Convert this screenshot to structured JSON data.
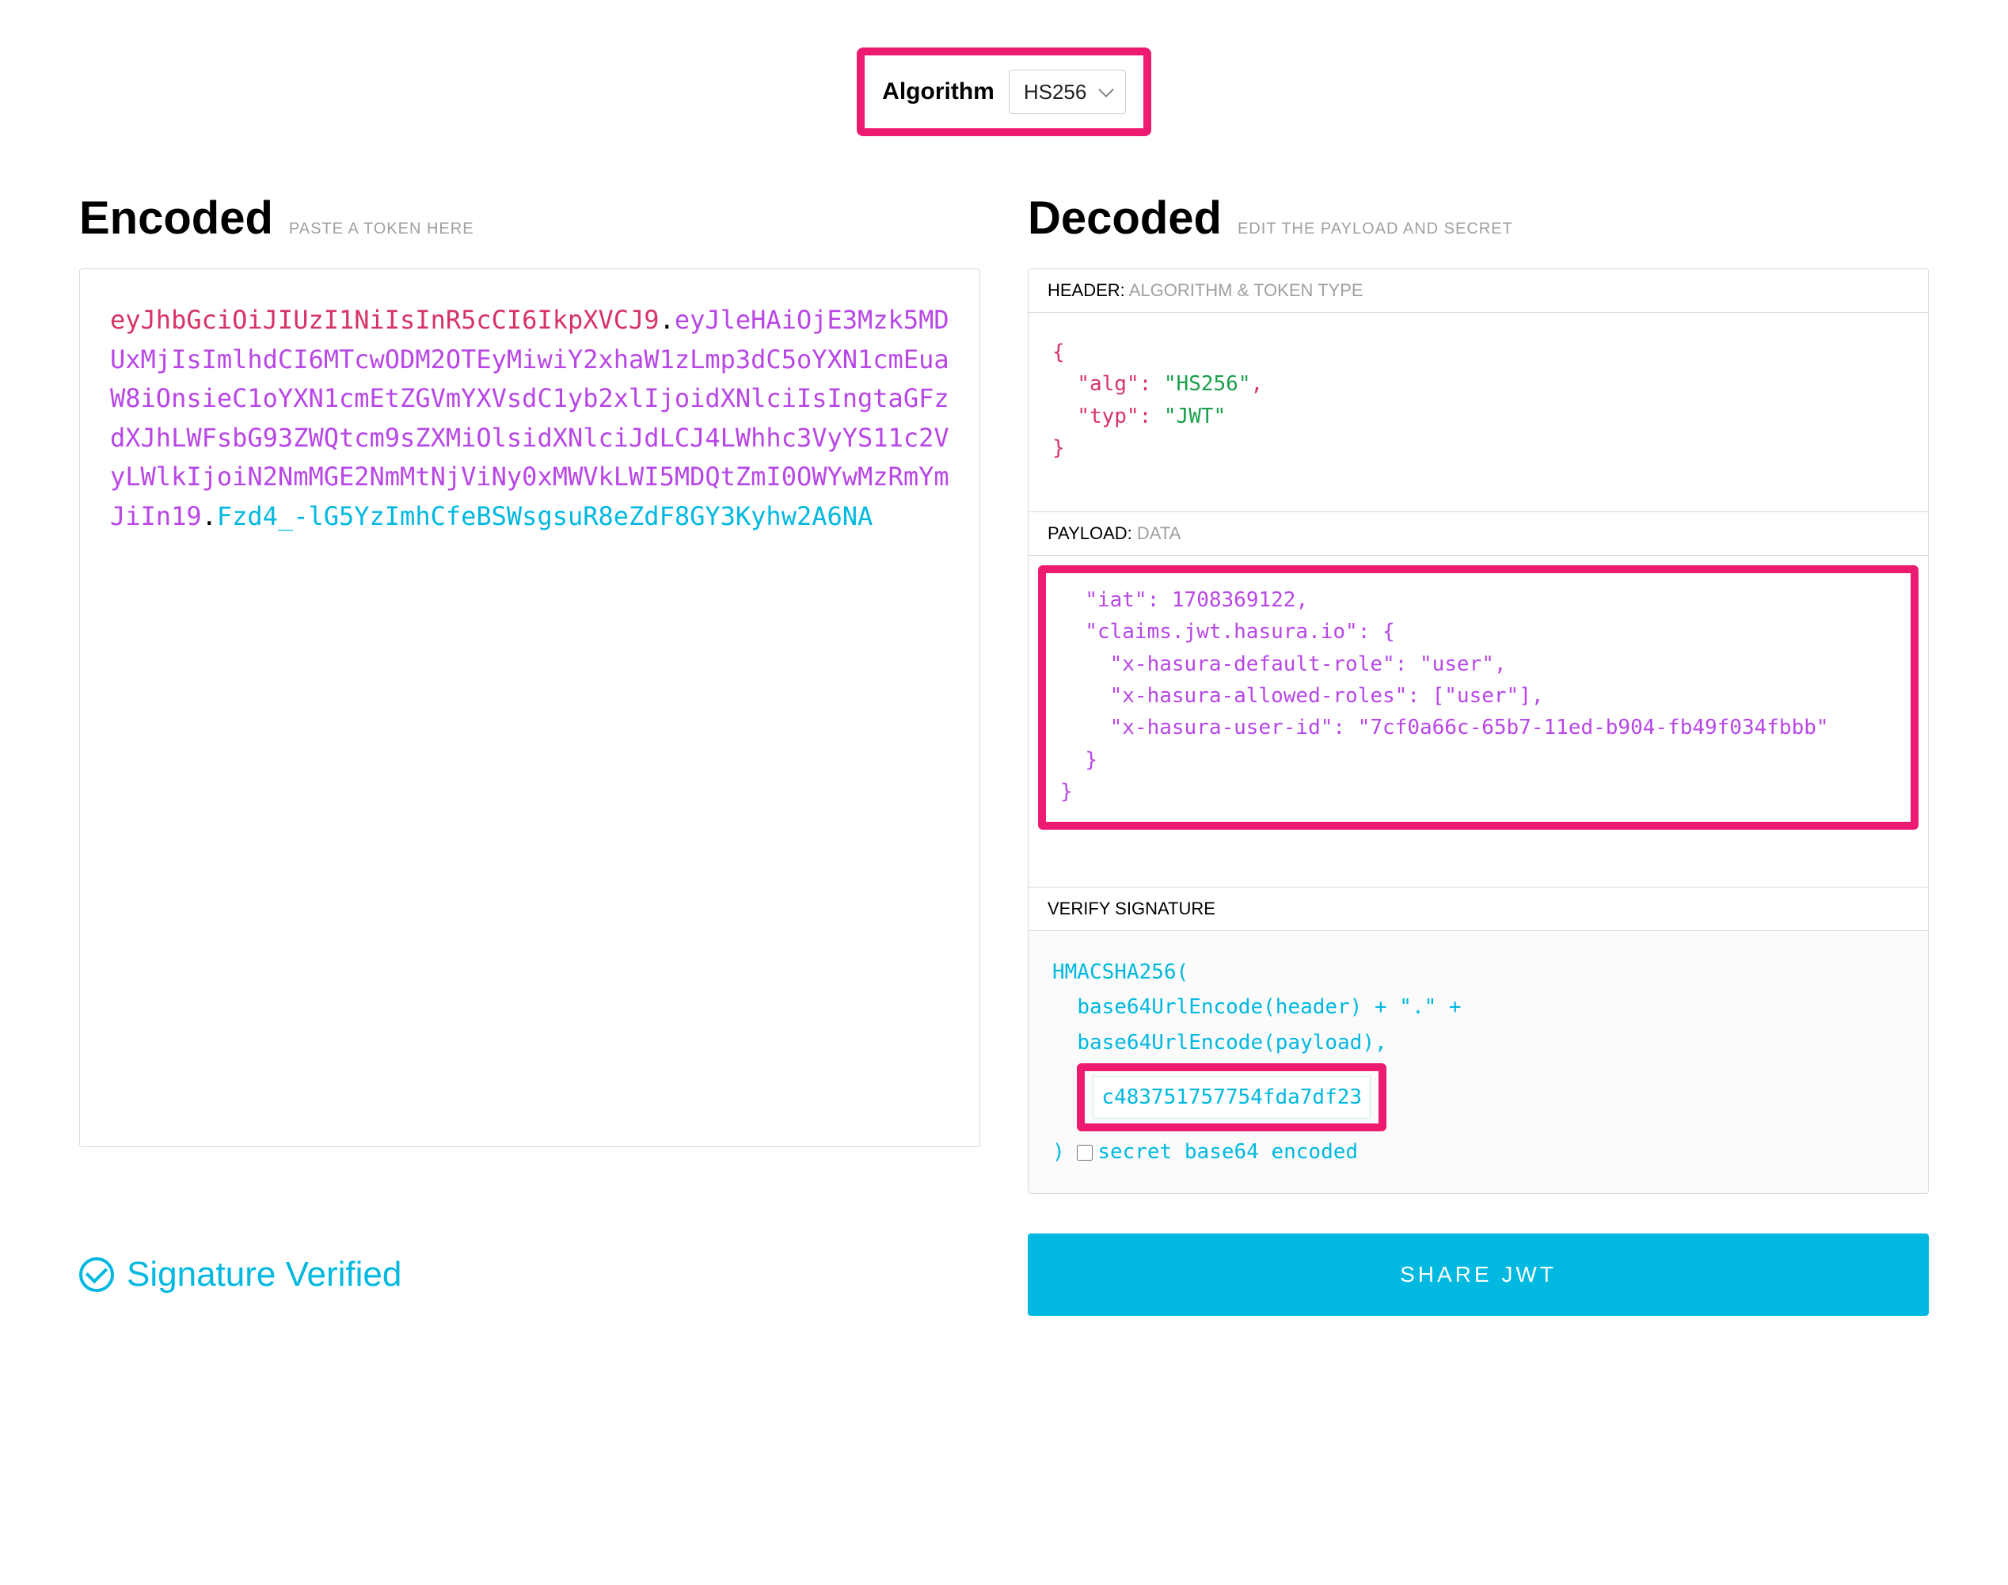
{
  "algorithm": {
    "label": "Algorithm",
    "selected": "HS256"
  },
  "encoded": {
    "title": "Encoded",
    "subtitle": "PASTE A TOKEN HERE",
    "token_header": "eyJhbGciOiJIUzI1NiIsInR5cCI6IkpXVCJ9",
    "token_payload": "eyJleHAiOjE3Mzk5MDUxMjIsImlhdCI6MTcwODM2OTEyMiwiY2xhaW1zLmp3dC5oYXN1cmEuaW8iOnsieC1oYXN1cmEtZGVmYXVsdC1yb2xlIjoidXNlciIsIngtaGFzdXJhLWFsbG93ZWQtcm9sZXMiOlsidXNlciJdLCJ4LWhhc3VyYS11c2VyLWlkIjoiN2NmMGE2NmMtNjViNy0xMWVkLWI5MDQtZmI0OWYwMzRmYmJiIn19",
    "token_signature": "Fzd4_-lG5YzImhCfeBSWsgsuR8eZdF8GY3Kyhw2A6NA"
  },
  "decoded": {
    "title": "Decoded",
    "subtitle": "EDIT THE PAYLOAD AND SECRET",
    "header_section": {
      "label_strong": "HEADER:",
      "label_sub": "ALGORITHM & TOKEN TYPE",
      "alg_key": "\"alg\"",
      "alg_val": "\"HS256\"",
      "typ_key": "\"typ\"",
      "typ_val": "\"JWT\""
    },
    "payload_section": {
      "label_strong": "PAYLOAD:",
      "label_sub": "DATA",
      "iat_key": "\"iat\"",
      "iat_val": "1708369122",
      "claims_key": "\"claims.jwt.hasura.io\"",
      "default_role_key": "\"x-hasura-default-role\"",
      "default_role_val": "\"user\"",
      "allowed_roles_key": "\"x-hasura-allowed-roles\"",
      "allowed_roles_val": "[\"user\"]",
      "user_id_key": "\"x-hasura-user-id\"",
      "user_id_val": "\"7cf0a66c-65b7-11ed-b904-fb49f034fbbb\""
    },
    "verify_section": {
      "label": "VERIFY SIGNATURE",
      "line1": "HMACSHA256(",
      "line2": "base64UrlEncode(header) + \".\" +",
      "line3": "base64UrlEncode(payload),",
      "secret": "c483751757754fda7df23",
      "line_close": ")",
      "checkbox_label": "secret base64 encoded"
    }
  },
  "footer": {
    "verified_text": "Signature Verified",
    "share_label": "SHARE JWT"
  }
}
